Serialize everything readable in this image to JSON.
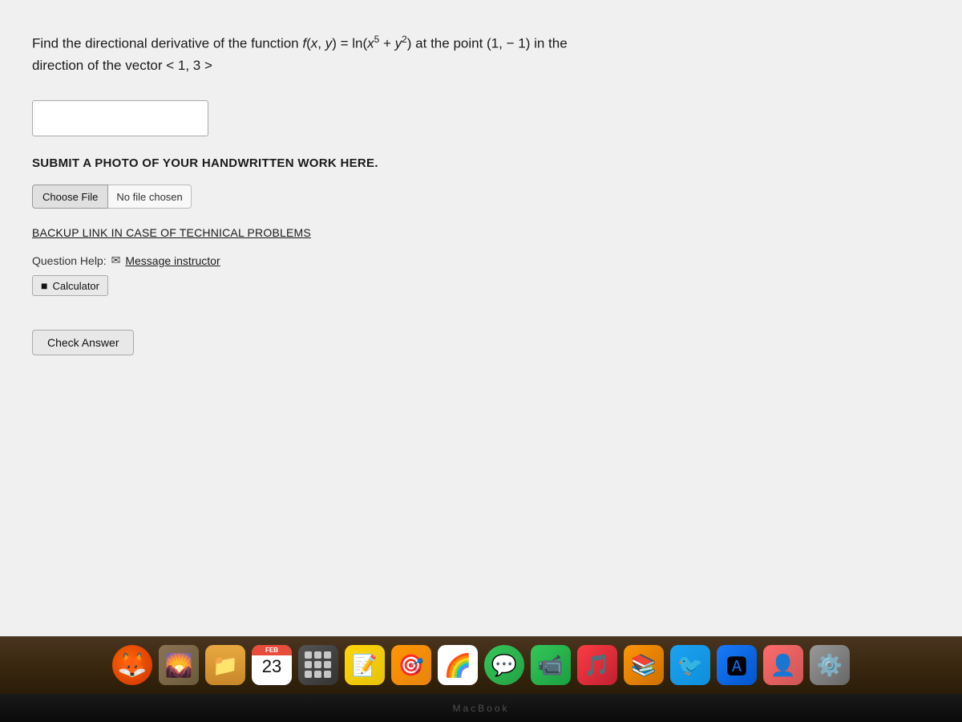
{
  "screen": {
    "problem": {
      "line1": "Find the directional derivative of the function f(x, y) = ln(x⁵ + y²) at the point (1, − 1) in the",
      "line2": "direction of the vector < 1, 3 >"
    },
    "submit_photo_label": "SUBMIT A PHOTO OF YOUR HANDWRITTEN WORK HERE.",
    "choose_file_btn": "Choose File",
    "no_file_text": "No file chosen",
    "backup_link": "BACKUP LINK IN CASE OF TECHNICAL PROBLEMS",
    "question_help_label": "Question Help:",
    "message_instructor_label": "Message instructor",
    "calculator_btn": "Calculator",
    "check_answer_btn": "Check Answer"
  },
  "dock": {
    "items": [
      {
        "name": "firefox",
        "label": "Firefox"
      },
      {
        "name": "photo",
        "label": "Photo"
      },
      {
        "name": "folder",
        "label": "Folder"
      },
      {
        "name": "calendar",
        "label": "Calendar",
        "month": "FEB",
        "day": "23"
      },
      {
        "name": "launchpad",
        "label": "Launchpad"
      },
      {
        "name": "notes",
        "label": "Notes"
      },
      {
        "name": "reminders",
        "label": "Reminders"
      },
      {
        "name": "photos",
        "label": "Photos"
      },
      {
        "name": "messages",
        "label": "Messages"
      },
      {
        "name": "facetime",
        "label": "FaceTime"
      },
      {
        "name": "music",
        "label": "Music"
      },
      {
        "name": "books",
        "label": "Books"
      },
      {
        "name": "twitter",
        "label": "Twitter"
      },
      {
        "name": "app-store",
        "label": "App Store"
      },
      {
        "name": "contacts",
        "label": "Contacts"
      },
      {
        "name": "system-prefs",
        "label": "System Preferences"
      }
    ]
  },
  "macbook_label": "MacBook"
}
